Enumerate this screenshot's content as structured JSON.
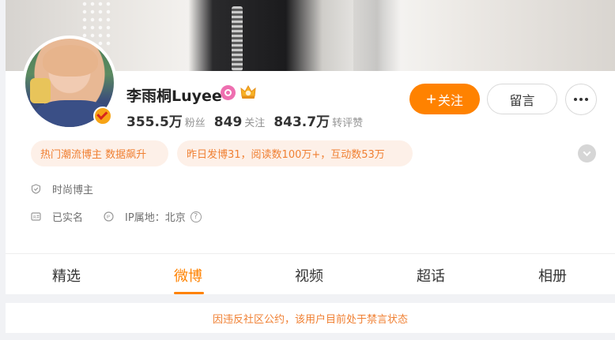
{
  "profile": {
    "name": "李雨桐Luyee",
    "stats": [
      {
        "value": "355.5万",
        "label": "粉丝"
      },
      {
        "value": "849",
        "label": "关注"
      },
      {
        "value": "843.7万",
        "label": "转评赞"
      }
    ],
    "tags": [
      "热门潮流博主 数据飙升",
      "昨日发博31，阅读数100万+，互动数53万"
    ],
    "info": {
      "category": "时尚博主",
      "verified_text": "已实名",
      "ip_location": "IP属地：北京"
    }
  },
  "actions": {
    "follow_label": "关注",
    "message_label": "留言"
  },
  "tabs": [
    {
      "label": "精选",
      "active": false
    },
    {
      "label": "微博",
      "active": true
    },
    {
      "label": "视频",
      "active": false
    },
    {
      "label": "超话",
      "active": false
    },
    {
      "label": "相册",
      "active": false
    }
  ],
  "notice": "因违反社区公约，该用户目前处于禁言状态",
  "icons": {
    "verified": "v-badge-icon",
    "pink_badge": "pink-medal-icon",
    "crown": "crown-icon",
    "shield": "shield-icon",
    "id_card": "id-card-icon",
    "ip": "ip-icon",
    "help": "question-icon",
    "more": "more-dots-icon",
    "expand": "chevron-down-icon"
  },
  "colors": {
    "accent": "#ff8200",
    "tag_bg": "#fdf0e8",
    "tag_text": "#f08033"
  }
}
